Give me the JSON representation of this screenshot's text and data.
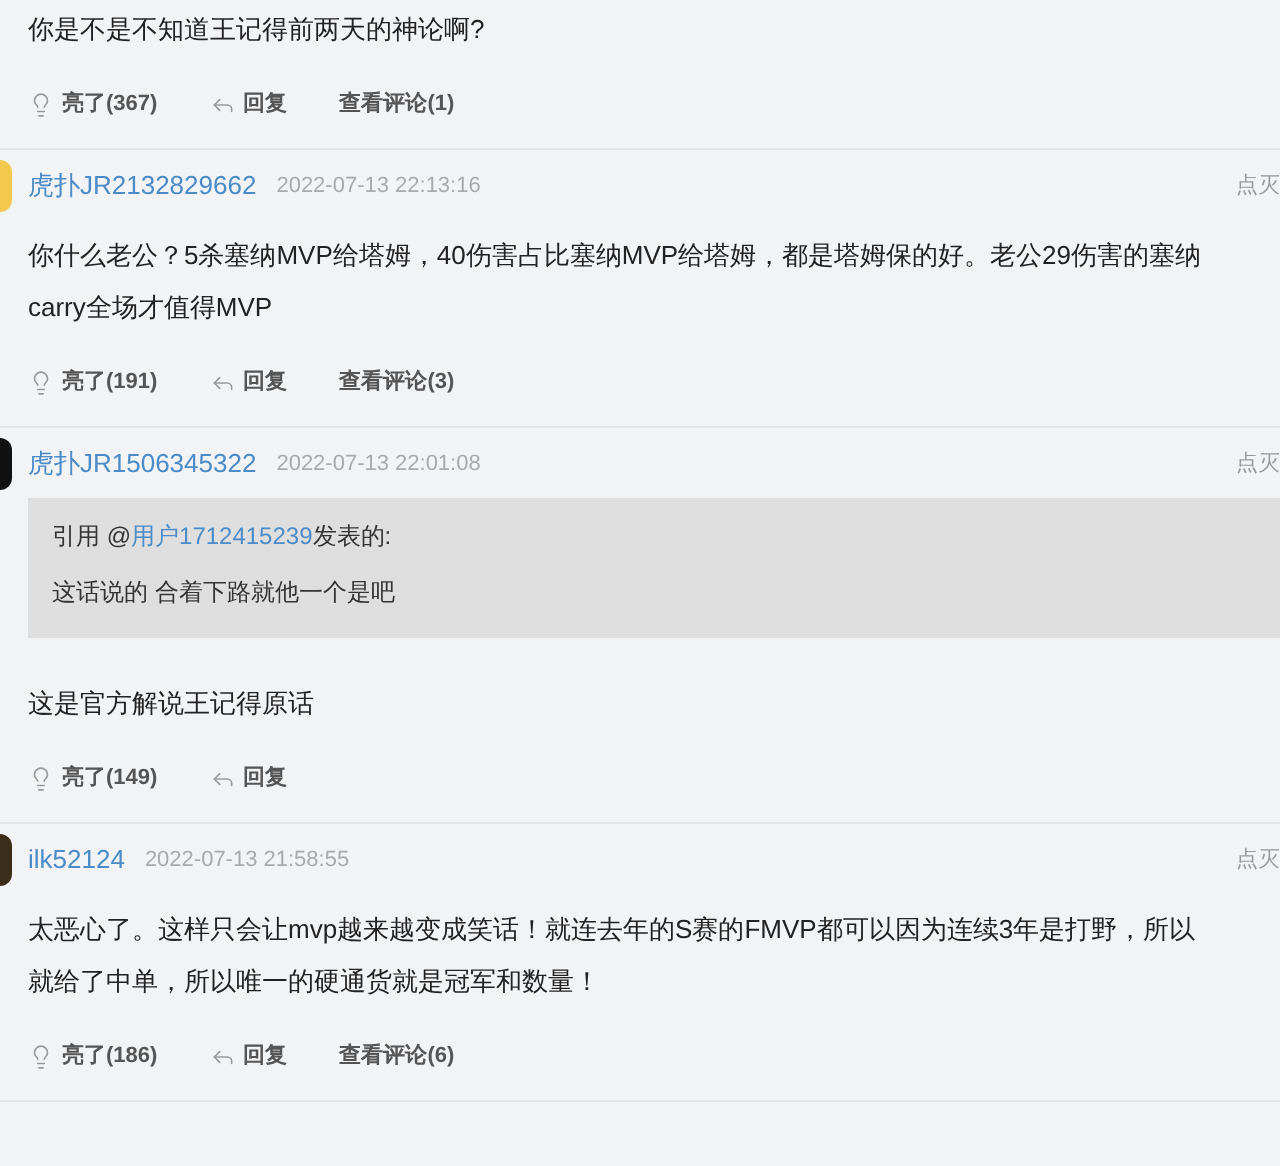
{
  "posts": [
    {
      "text": "你是不是不知道王记得前两天的神论啊?",
      "actions": {
        "likes": "亮了(367)",
        "reply": "回复",
        "comments": "查看评论(1)"
      }
    },
    {
      "author": "虎扑JR2132829662",
      "date": "2022-07-13 22:13:16",
      "dislike": "点灭",
      "avatar": {
        "color": "#f2c94c"
      },
      "text": "你什么老公？5杀塞纳MVP给塔姆，40伤害占比塞纳MVP给塔姆，都是塔姆保的好。老公29伤害的塞纳carry全场才值得MVP",
      "actions": {
        "likes": "亮了(191)",
        "reply": "回复",
        "comments": "查看评论(3)"
      }
    },
    {
      "author": "虎扑JR1506345322",
      "date": "2022-07-13 22:01:08",
      "dislike": "点灭",
      "avatar": {
        "color": "#111111"
      },
      "quote": {
        "prefix": "引用 @",
        "user": "用户1712415239",
        "suffix": "发表的:",
        "text": "这话说的 合着下路就他一个是吧"
      },
      "text": "这是官方解说王记得原话",
      "actions": {
        "likes": "亮了(149)",
        "reply": "回复"
      }
    },
    {
      "author": "ilk52124",
      "date": "2022-07-13 21:58:55",
      "dislike": "点灭",
      "avatar": {
        "color": "#3a2e1a"
      },
      "text": "太恶心了。这样只会让mvp越来越变成笑话！就连去年的S赛的FMVP都可以因为连续3年是打野，所以就给了中单，所以唯一的硬通货就是冠军和数量！",
      "actions": {
        "likes": "亮了(186)",
        "reply": "回复",
        "comments": "查看评论(6)"
      }
    }
  ]
}
